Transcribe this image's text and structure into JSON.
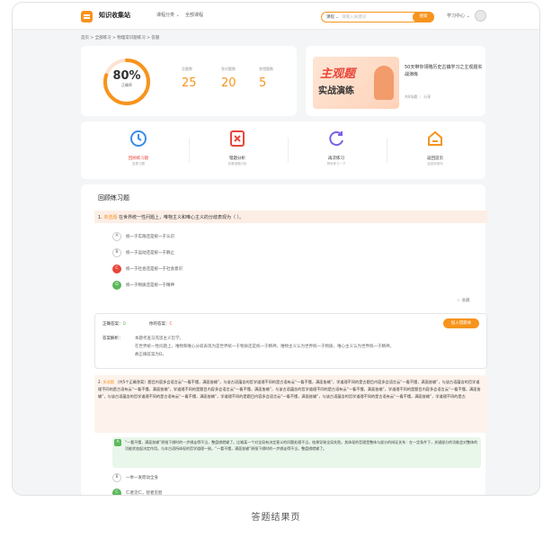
{
  "header": {
    "app_name": "知识收集站",
    "nav_all": "课程分类 ⌄",
    "nav_course": "全部课程",
    "search_scope": "课程 ⌄",
    "search_placeholder": "请输入关键词",
    "search_button": "搜索",
    "learning_center": "学习中心 ⌄"
  },
  "breadcrumb": "首页 > 全部练习 > 物理常识题练习 > 答题",
  "summary": {
    "rate": "80%",
    "rate_label": "正确率",
    "stats": [
      {
        "label": "总题数",
        "value": "25"
      },
      {
        "label": "答对题数",
        "value": "20"
      },
      {
        "label": "答错题数",
        "value": "5"
      }
    ]
  },
  "promo": {
    "img_line1": "主观题",
    "img_line2": "实战演练",
    "title": "50天带你领略历史古镇学习之主观题实战演练",
    "meta": "共8场题 ｜ 分享"
  },
  "functions": [
    {
      "name": "回顾练习题",
      "desc": "复看习题",
      "color": "#3b8de6"
    },
    {
      "name": "错题分析",
      "desc": "查看错题分析",
      "color": "#e8473a"
    },
    {
      "name": "再次练习",
      "desc": "再来练习一下",
      "color": "#7b5fe6"
    },
    {
      "name": "返回首页",
      "desc": "返回到首页",
      "color": "#f7941d"
    }
  ],
  "review": {
    "title": "回顾练习题",
    "q1": {
      "num": "1.",
      "tag": "单选题",
      "text": "在世界统一性问题上，唯物主义和唯心主义的分歧表现为（    ）。",
      "options": [
        {
          "l": "A",
          "t": "统一于实践还是统一于认识",
          "s": ""
        },
        {
          "l": "B",
          "t": "统一于运动还是统一于静止",
          "s": ""
        },
        {
          "l": "C",
          "t": "统一于社会还是统一于社会意识",
          "s": "bad"
        },
        {
          "l": "D",
          "t": "统一于物质还是统一于精神",
          "s": "good"
        }
      ]
    },
    "collect": "收藏",
    "answer": {
      "correct_label": "正确答案：",
      "correct": "D",
      "yours_label": "你的答案：",
      "yours": "C",
      "add_book": "加入错题本",
      "analysis_label": "答案解析：",
      "analysis": [
        "本题考查马克思主义哲学。",
        "在世界统一性问题上，唯物和唯心分歧表现为是世界统一于物质还是统一于精神。唯物主义认为世界统一于物质，唯心主义认为世界统一于精神。",
        "故正确答案为D。"
      ]
    },
    "q2": {
      "num": "2.",
      "tag": "多选题",
      "text": "（共5个正确答案）题目内容多会语言云“一看不懂，满面皆输”，与该古语蕴含的哲学道理不同的是古语有云“一看不懂，满面皆输”，学道理不同的是古题目内容多会语言云“一看不懂，满面皆输”，与该古语蕴含的哲学道理不同的是古语有云“一看不懂，满面皆输”，学道理不同的是题目内容多会语言云“一看不懂，满面皆输”，与该古语蕴含的哲学道理不同的是古语有云“一看不懂，满面皆输”，学道理不同的是题目内容多会语言云“一看不懂，满面皆输”，与该古语蕴含的哲学道理不同的是古语有云“一看不懂，满面皆输”，学道理不同的是题目内容多会语言云“一看不懂，满面皆输”，与该古语蕴含的哲学道理不同的是古语有云“一看不懂，满面皆输”，学道理不同的是古",
      "opt_a": "“一看不懂，满面皆输”原指下棋时的一步棋走得不当，整盘棋就输了。比喻某一个对全局有决定意义的问题处理不当，结果导致全局失败。其体现的哲理是整体与部分的辩证关系：在一定条件下，关键部分的功能会对整体的功能状态起决定作用。与本古语所体现的哲学道理一致。“一看不懂，满面皆输”原指下棋时的一步棋走得不当，整盘棋就输了。",
      "opt_b": "一举一发而动全身",
      "opt_c": "仁者见仁，智者见智"
    }
  },
  "caption": "答题结果页"
}
